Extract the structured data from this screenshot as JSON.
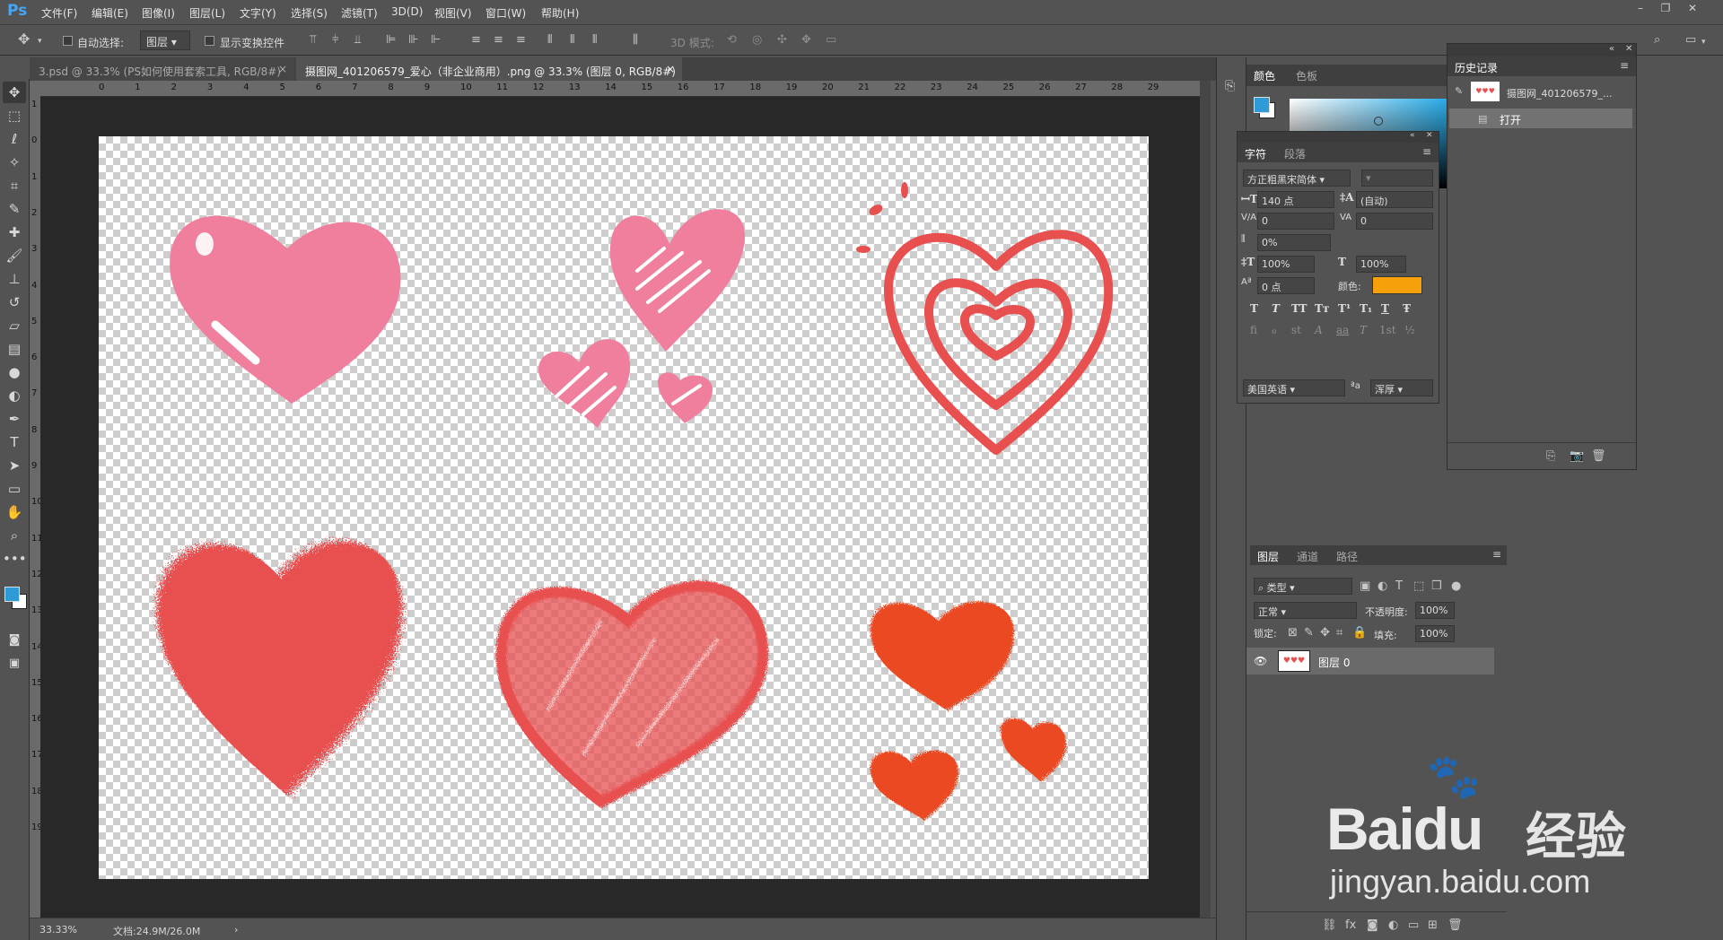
{
  "app": {
    "logo": "Ps"
  },
  "menu": [
    "文件(F)",
    "编辑(E)",
    "图像(I)",
    "图层(L)",
    "文字(Y)",
    "选择(S)",
    "滤镜(T)",
    "3D(D)",
    "视图(V)",
    "窗口(W)",
    "帮助(H)"
  ],
  "options": {
    "auto_select_label": "自动选择:",
    "layer_select": "图层",
    "show_transform_label": "显示变换控件",
    "mode_3d_label": "3D 模式:"
  },
  "tabs": [
    {
      "label": "3.psd @ 33.3% (PS如何使用套索工具, RGB/8#)",
      "close": "×"
    },
    {
      "label": "摄图网_401206579_爱心（非企业商用）.png @ 33.3% (图层 0, RGB/8#)",
      "close": "×"
    }
  ],
  "ruler": {
    "top": [
      "0",
      "1",
      "2",
      "3",
      "4",
      "5",
      "6",
      "7",
      "8",
      "9",
      "10",
      "11",
      "12",
      "13",
      "14",
      "15",
      "16",
      "17",
      "18",
      "19",
      "20",
      "21",
      "22",
      "23",
      "24",
      "25",
      "26",
      "27",
      "28",
      "29"
    ],
    "left": [
      "1",
      "0",
      "1",
      "2",
      "3",
      "4",
      "5",
      "6",
      "7",
      "8",
      "9",
      "10",
      "11",
      "12",
      "13",
      "14",
      "15",
      "16",
      "17",
      "18",
      "19"
    ]
  },
  "status": {
    "zoom": "33.33%",
    "doc": "文档:24.9M/26.0M",
    "arrow": "›"
  },
  "color_panel": {
    "tabs": [
      "颜色",
      "色板"
    ]
  },
  "character_panel": {
    "tabs": [
      "字符",
      "段落"
    ],
    "font_family": "方正粗黑宋简体",
    "font_style": "",
    "size": "140 点",
    "leading": "(自动)",
    "kerning": "0",
    "tracking": "0",
    "scale_tsume": "0%",
    "vscale": "100%",
    "hscale": "100%",
    "baseline": "0 点",
    "color_label": "颜色:",
    "color_value": "#f7a10a",
    "lang": "美国英语",
    "aa_label": "ªa",
    "aa": "浑厚",
    "glyphs_row1": [
      "T",
      "T",
      "TT",
      "Tт",
      "T¹",
      "T₁",
      "T",
      "Ŧ"
    ],
    "glyphs_row2": [
      "fi",
      "ℴ",
      "st",
      "A",
      "aa",
      "T",
      "1st",
      "½"
    ]
  },
  "history_panel": {
    "title": "历史记录",
    "snapshot": "摄图网_401206579_...",
    "items": [
      "打开"
    ]
  },
  "layers_panel": {
    "tabs": [
      "图层",
      "通道",
      "路径"
    ],
    "filter": "类型",
    "blend": "正常",
    "opacity_label": "不透明度:",
    "opacity": "100%",
    "lock_label": "锁定:",
    "fill_label": "填充:",
    "fill": "100%",
    "layers": [
      {
        "name": "图层 0",
        "visible": true
      }
    ]
  },
  "watermark": {
    "brand": "Bai",
    "brand2": "du",
    "brand_cn": "经验",
    "url": "jingyan.baidu.com"
  },
  "colors": {
    "fg": "#2f9bd6",
    "bg": "#ffffff",
    "pink": "#ef7f9c",
    "red": "#e84f4f",
    "orange": "#ea4a24"
  }
}
